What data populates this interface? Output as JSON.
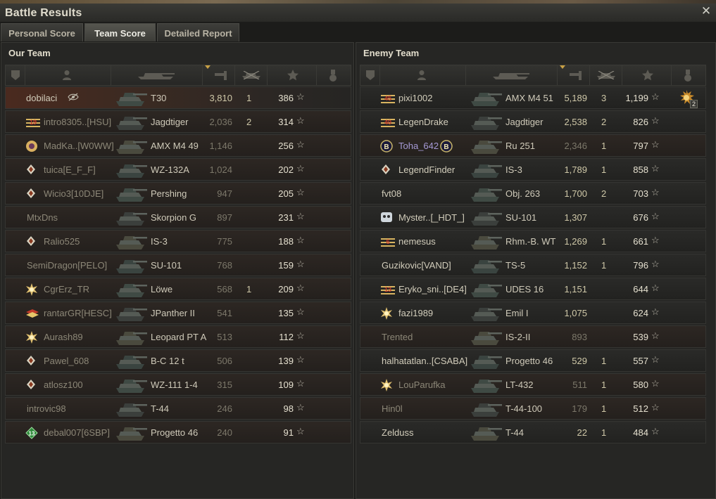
{
  "window": {
    "title": "Battle Results",
    "close_icon": "close-icon"
  },
  "tabs": [
    {
      "label": "Personal Score",
      "active": false
    },
    {
      "label": "Team Score",
      "active": true
    },
    {
      "label": "Detailed Report",
      "active": false
    }
  ],
  "our_team": {
    "title": "Our Team",
    "rows": [
      {
        "name": "dobilaci",
        "tank": "T30",
        "damage": "3,810",
        "kills": "1",
        "xp": "386",
        "badge": "eye-off-icon",
        "dead": false,
        "self": true
      },
      {
        "name": "intro8305..[HSU]",
        "tank": "Jagdtiger",
        "damage": "2,036",
        "kills": "2",
        "xp": "314",
        "badge": "rank-19-icon",
        "dead": true
      },
      {
        "name": "MadKa..[W0WW]",
        "tank": "AMX M4 49",
        "damage": "1,146",
        "kills": "",
        "xp": "256",
        "badge": "clan-emblem-icon",
        "dead": true
      },
      {
        "name": "tuica[E_F_F]",
        "tank": "WZ-132A",
        "damage": "1,024",
        "kills": "",
        "xp": "202",
        "badge": "diamond-rank-icon",
        "dead": true
      },
      {
        "name": "Wicio3[10DJE]",
        "tank": "Pershing",
        "damage": "947",
        "kills": "",
        "xp": "205",
        "badge": "diamond-rank-icon",
        "dead": true
      },
      {
        "name": "MtxDns",
        "tank": "Skorpion G",
        "damage": "897",
        "kills": "",
        "xp": "231",
        "badge": "",
        "dead": true
      },
      {
        "name": "Ralio525",
        "tank": "IS-3",
        "damage": "775",
        "kills": "",
        "xp": "188",
        "badge": "diamond-rank-icon",
        "dead": true
      },
      {
        "name": "SemiDragon[PELO]",
        "tank": "SU-101",
        "damage": "768",
        "kills": "",
        "xp": "159",
        "badge": "",
        "dead": true
      },
      {
        "name": "CgrErz_TR",
        "tank": "Löwe",
        "damage": "568",
        "kills": "1",
        "xp": "209",
        "badge": "gold-star-icon",
        "dead": true
      },
      {
        "name": "rantarGR[HESC]",
        "tank": "JPanther II",
        "damage": "541",
        "kills": "",
        "xp": "135",
        "badge": "rank-chevron-icon",
        "dead": true
      },
      {
        "name": "Aurash89",
        "tank": "Leopard PT A",
        "damage": "513",
        "kills": "",
        "xp": "112",
        "badge": "gold-star-icon",
        "dead": true
      },
      {
        "name": "Pawel_608",
        "tank": "B-C 12 t",
        "damage": "506",
        "kills": "",
        "xp": "139",
        "badge": "diamond-rank-icon",
        "dead": true
      },
      {
        "name": "atlosz100",
        "tank": "WZ-111 1-4",
        "damage": "315",
        "kills": "",
        "xp": "109",
        "badge": "diamond-rank-icon",
        "dead": true
      },
      {
        "name": "introvic98",
        "tank": "T-44",
        "damage": "246",
        "kills": "",
        "xp": "98",
        "badge": "",
        "dead": true
      },
      {
        "name": "debal007[6SBP]",
        "tank": "Progetto 46",
        "damage": "240",
        "kills": "",
        "xp": "91",
        "badge": "green-rank-13-icon",
        "dead": true
      }
    ]
  },
  "enemy_team": {
    "title": "Enemy Team",
    "rows": [
      {
        "name": "pixi1002",
        "tank": "AMX M4 51",
        "damage": "5,189",
        "kills": "3",
        "xp": "1,199",
        "badge": "rank-45-icon",
        "dead": false,
        "medal": "ace-medal-icon",
        "medal_count": "2"
      },
      {
        "name": "LegenDrake",
        "tank": "Jagdtiger",
        "damage": "2,538",
        "kills": "2",
        "xp": "826",
        "badge": "rank-40-icon",
        "dead": false
      },
      {
        "name": "Toha_642",
        "tank": "Ru 251",
        "damage": "2,346",
        "kills": "1",
        "xp": "797",
        "badge": "b-rank-icon",
        "dead": true,
        "purple": true
      },
      {
        "name": "LegendFinder",
        "tank": "IS-3",
        "damage": "1,789",
        "kills": "1",
        "xp": "858",
        "badge": "diamond-rank-icon",
        "dead": false
      },
      {
        "name": "fvt08",
        "tank": "Obj. 263",
        "damage": "1,700",
        "kills": "2",
        "xp": "703",
        "badge": "",
        "dead": false
      },
      {
        "name": "Myster..[_HDT_]",
        "tank": "SU-101",
        "damage": "1,307",
        "kills": "",
        "xp": "676",
        "badge": "skull-emblem-icon",
        "dead": false
      },
      {
        "name": "nemesus",
        "tank": "Rhm.-B. WT",
        "damage": "1,269",
        "kills": "1",
        "xp": "661",
        "badge": "rank-6-icon",
        "dead": false
      },
      {
        "name": "Guzikovic[VAND]",
        "tank": "TS-5",
        "damage": "1,152",
        "kills": "1",
        "xp": "796",
        "badge": "",
        "dead": false
      },
      {
        "name": "Eryko_sni..[DE4]",
        "tank": "UDES 16",
        "damage": "1,151",
        "kills": "",
        "xp": "644",
        "badge": "rank-13-icon",
        "dead": false
      },
      {
        "name": "fazi1989",
        "tank": "Emil I",
        "damage": "1,075",
        "kills": "",
        "xp": "624",
        "badge": "gold-star-icon",
        "dead": false
      },
      {
        "name": "Trented",
        "tank": "IS-2-II",
        "damage": "893",
        "kills": "",
        "xp": "539",
        "badge": "",
        "dead": true
      },
      {
        "name": "halhatatlan..[CSABA]",
        "tank": "Progetto 46",
        "damage": "529",
        "kills": "1",
        "xp": "557",
        "badge": "",
        "dead": false
      },
      {
        "name": "LouParufka",
        "tank": "LT-432",
        "damage": "511",
        "kills": "1",
        "xp": "580",
        "badge": "gold-star-icon",
        "dead": true
      },
      {
        "name": "Hin0l",
        "tank": "T-44-100",
        "damage": "179",
        "kills": "1",
        "xp": "512",
        "badge": "",
        "dead": true
      },
      {
        "name": "Zelduss",
        "tank": "T-44",
        "damage": "22",
        "kills": "1",
        "xp": "484",
        "badge": "",
        "dead": false
      }
    ]
  },
  "columns": [
    "platoon-icon",
    "player-icon",
    "tank-icon",
    "damage-icon",
    "kills-icon",
    "xp-icon",
    "medal-icon"
  ],
  "colors": {
    "background": "#1c1c1a",
    "row": "#2a2a28",
    "self_row": "#4a2a1f",
    "text": "#d2cdbb",
    "dead_text": "#8c8777",
    "purple": "#a69ad6"
  }
}
